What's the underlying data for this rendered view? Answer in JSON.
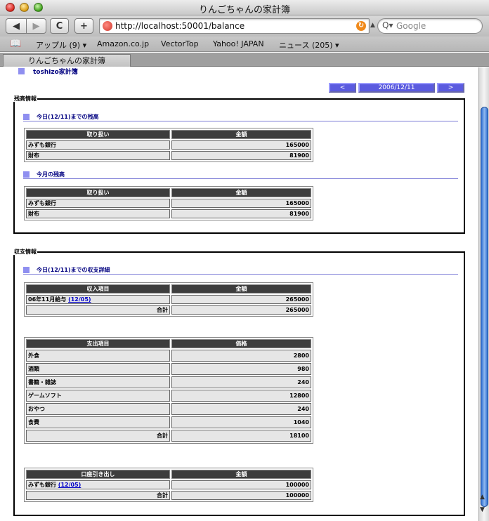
{
  "window": {
    "title": "りんごちゃんの家計簿"
  },
  "toolbar": {
    "back_glyph": "◀",
    "forward_glyph": "▶",
    "reload_glyph": "C",
    "add_glyph": "+",
    "url": "http://localhost:50001/balance",
    "search_placeholder": "Google",
    "search_glyph": "Q▾"
  },
  "bookmarks": [
    {
      "label": "アップル (9) ▾"
    },
    {
      "label": "Amazon.co.jp"
    },
    {
      "label": "VectorTop"
    },
    {
      "label": "Yahoo! JAPAN"
    },
    {
      "label": "ニュース (205) ▾"
    }
  ],
  "tab": {
    "label": "りんごちゃんの家計簿"
  },
  "page": {
    "user_header": "toshizo家計簿",
    "nav": {
      "prev": "<",
      "date": "2006/12/11",
      "next": ">"
    },
    "balance": {
      "legend": "残高情報",
      "sections": [
        {
          "title": "今日(12/11)までの残高",
          "headers": [
            "取り扱い",
            "金額"
          ],
          "rows": [
            {
              "name": "みずも銀行",
              "amount": "165000"
            },
            {
              "name": "財布",
              "amount": "81900"
            }
          ]
        },
        {
          "title": "今月の残高",
          "headers": [
            "取り扱い",
            "金額"
          ],
          "rows": [
            {
              "name": "みずも銀行",
              "amount": "165000"
            },
            {
              "name": "財布",
              "amount": "81900"
            }
          ]
        }
      ]
    },
    "income": {
      "legend": "収支情報",
      "title": "今日(12/11)までの収支詳細",
      "income_table": {
        "headers": [
          "収入項目",
          "金額"
        ],
        "rows": [
          {
            "name": "06年11月給与",
            "link": "(12/05)",
            "amount": "265000"
          }
        ],
        "total_label": "合計",
        "total": "265000"
      },
      "expense_table": {
        "headers": [
          "支出項目",
          "価格"
        ],
        "rows": [
          {
            "name": "外食",
            "amount": "2800"
          },
          {
            "name": "酒類",
            "amount": "980"
          },
          {
            "name": "書籍・雑誌",
            "amount": "240"
          },
          {
            "name": "ゲームソフト",
            "amount": "12800"
          },
          {
            "name": "おやつ",
            "amount": "240"
          },
          {
            "name": "食費",
            "amount": "1040"
          }
        ],
        "total_label": "合計",
        "total": "18100"
      },
      "withdraw_table": {
        "headers": [
          "口座引き出し",
          "金額"
        ],
        "rows": [
          {
            "name": "みずも銀行",
            "link": "(12/05)",
            "amount": "100000"
          }
        ],
        "total_label": "合計",
        "total": "100000"
      }
    }
  },
  "colors": {
    "header_cell": "#3d3d3d",
    "data_cell": "#e6e6e6",
    "accent_square": "#8f8ff0",
    "nav_button": "#5b5bdf",
    "link": "#0000c8",
    "heading_text": "#000080"
  }
}
